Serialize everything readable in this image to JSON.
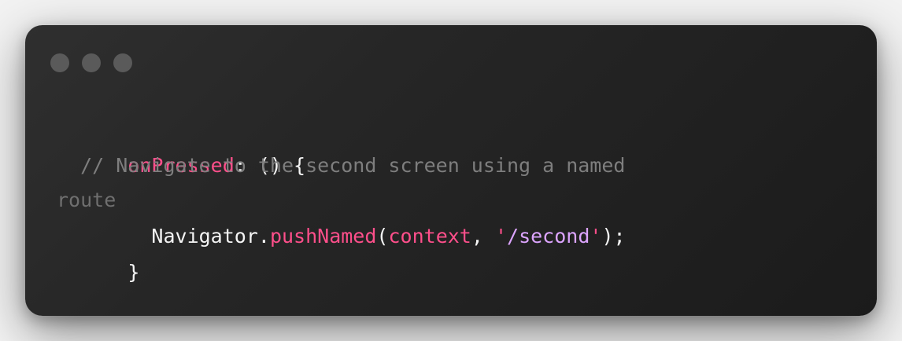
{
  "window": {
    "colors": {
      "background": "#232323",
      "dot": "#5a5a5a",
      "pink": "#ff4f8b",
      "purple": "#dca4ff",
      "white": "#f4f4f4",
      "comment": "#7e7e7e"
    }
  },
  "code": {
    "line1": {
      "prop": "onPressed",
      "rest": ": () {"
    },
    "line2": {
      "comment": "  // Navigate to the second screen using a named"
    },
    "line3": {
      "comment_wrap": "route",
      "indent": "  ",
      "object": "Navigator",
      "dot": ".",
      "method": "pushNamed",
      "open": "(",
      "arg1": "context",
      "comma": ", ",
      "quote_open": "'",
      "arg2": "/second",
      "quote_close": "'",
      "close": ");"
    },
    "line4": {
      "brace": "}"
    }
  }
}
